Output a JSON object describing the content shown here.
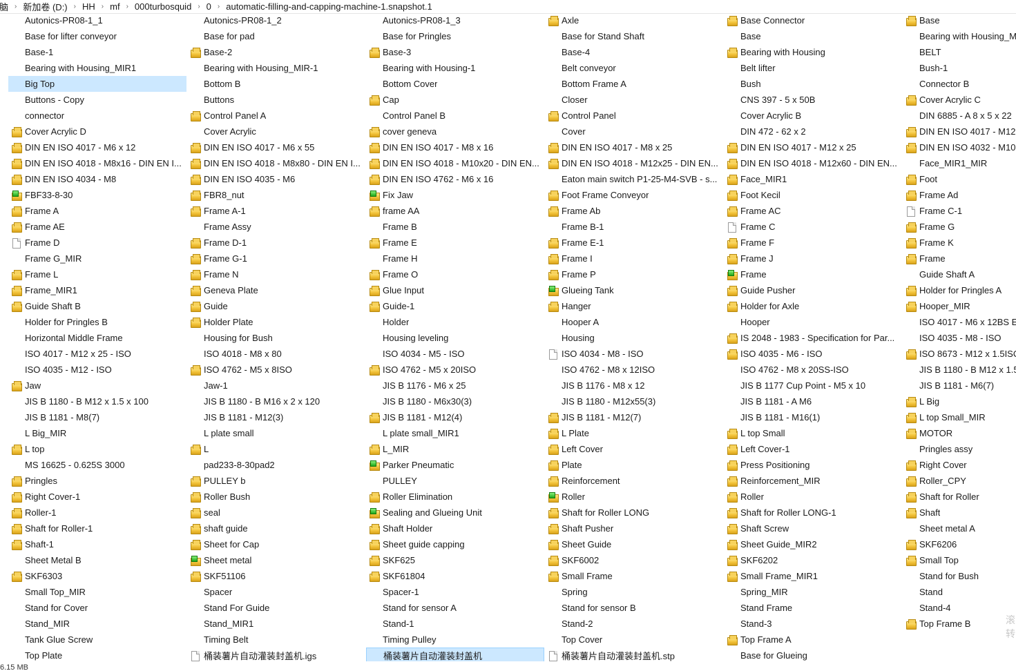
{
  "breadcrumb": [
    "脑",
    "新加卷 (D:)",
    "HH",
    "mf",
    "000turbosquid",
    "0",
    "automatic-filling-and-capping-machine-1.snapshot.1"
  ],
  "status_bar": "6.15 MB",
  "ime_text": "滚\n转",
  "files": [
    {
      "name": "Autonics-PR08-1_1",
      "icon": "none"
    },
    {
      "name": "Base for lifter conveyor",
      "icon": "none"
    },
    {
      "name": "Base-1",
      "icon": "none"
    },
    {
      "name": "Bearing with Housing_MIR1",
      "icon": "none"
    },
    {
      "name": "Big Top",
      "icon": "none",
      "selected": true
    },
    {
      "name": "Buttons - Copy",
      "icon": "none"
    },
    {
      "name": "connector",
      "icon": "none"
    },
    {
      "name": "Cover Acrylic D",
      "icon": "part"
    },
    {
      "name": "DIN EN ISO 4017 - M6 x 12",
      "icon": "part"
    },
    {
      "name": "DIN EN ISO 4018 - M8x16 - DIN EN I...",
      "icon": "part"
    },
    {
      "name": "DIN EN ISO 4034 - M8",
      "icon": "part"
    },
    {
      "name": "FBF33-8-30",
      "icon": "asm"
    },
    {
      "name": "Frame A",
      "icon": "part"
    },
    {
      "name": "Frame AE",
      "icon": "part"
    },
    {
      "name": "Frame D",
      "icon": "file"
    },
    {
      "name": "Frame G_MIR",
      "icon": "none"
    },
    {
      "name": "Frame L",
      "icon": "part"
    },
    {
      "name": "Frame_MIR1",
      "icon": "part"
    },
    {
      "name": "Guide Shaft B",
      "icon": "part"
    },
    {
      "name": "Holder for Pringles B",
      "icon": "none"
    },
    {
      "name": "Horizontal Middle Frame",
      "icon": "none"
    },
    {
      "name": "ISO 4017 - M12 x 25 - ISO",
      "icon": "none"
    },
    {
      "name": "ISO 4035 - M12 - ISO",
      "icon": "none"
    },
    {
      "name": "Jaw",
      "icon": "part"
    },
    {
      "name": "JIS B 1180 - B M12 x 1.5 x 100",
      "icon": "none"
    },
    {
      "name": "JIS B 1181 - M8(7)",
      "icon": "none"
    },
    {
      "name": "L Big_MIR",
      "icon": "none"
    },
    {
      "name": "L top",
      "icon": "part"
    },
    {
      "name": "MS 16625 - 0.625S 3000",
      "icon": "none"
    },
    {
      "name": "Pringles",
      "icon": "part"
    },
    {
      "name": "Right Cover-1",
      "icon": "part"
    },
    {
      "name": "Roller-1",
      "icon": "part"
    },
    {
      "name": "Shaft for Roller-1",
      "icon": "part"
    },
    {
      "name": "Shaft-1",
      "icon": "part"
    },
    {
      "name": "Sheet Metal B",
      "icon": "none"
    },
    {
      "name": "SKF6303",
      "icon": "part"
    },
    {
      "name": "Small Top_MIR",
      "icon": "none"
    },
    {
      "name": "Stand for Cover",
      "icon": "none"
    },
    {
      "name": "Stand_MIR",
      "icon": "none"
    },
    {
      "name": "Tank Glue Screw",
      "icon": "none"
    },
    {
      "name": "Top Plate",
      "icon": "none"
    },
    {
      "name": "Autonics-PR08-1_2",
      "icon": "none"
    },
    {
      "name": "Base for pad",
      "icon": "none"
    },
    {
      "name": "Base-2",
      "icon": "part"
    },
    {
      "name": "Bearing with Housing_MIR-1",
      "icon": "none"
    },
    {
      "name": "Bottom B",
      "icon": "none"
    },
    {
      "name": "Buttons",
      "icon": "none"
    },
    {
      "name": "Control Panel A",
      "icon": "part"
    },
    {
      "name": "Cover Acrylic",
      "icon": "none"
    },
    {
      "name": "DIN EN ISO 4017 - M6 x 55",
      "icon": "part"
    },
    {
      "name": "DIN EN ISO 4018 - M8x80 - DIN EN I...",
      "icon": "part"
    },
    {
      "name": "DIN EN ISO 4035 - M6",
      "icon": "part"
    },
    {
      "name": "FBR8_nut",
      "icon": "part"
    },
    {
      "name": "Frame A-1",
      "icon": "part"
    },
    {
      "name": "Frame Assy",
      "icon": "none"
    },
    {
      "name": "Frame D-1",
      "icon": "part"
    },
    {
      "name": "Frame G-1",
      "icon": "part"
    },
    {
      "name": "Frame N",
      "icon": "part"
    },
    {
      "name": "Geneva Plate",
      "icon": "part"
    },
    {
      "name": "Guide",
      "icon": "part"
    },
    {
      "name": "Holder Plate",
      "icon": "part"
    },
    {
      "name": "Housing for Bush",
      "icon": "none"
    },
    {
      "name": "ISO 4018 - M8 x 80",
      "icon": "none"
    },
    {
      "name": "ISO 4762 - M5 x 8ISO",
      "icon": "part"
    },
    {
      "name": "Jaw-1",
      "icon": "none"
    },
    {
      "name": "JIS B 1180 - B M16 x 2 x 120",
      "icon": "none"
    },
    {
      "name": "JIS B 1181 - M12(3)",
      "icon": "none"
    },
    {
      "name": "L plate small",
      "icon": "none"
    },
    {
      "name": "L",
      "icon": "part"
    },
    {
      "name": "pad233-8-30pad2",
      "icon": "none"
    },
    {
      "name": "PULLEY b",
      "icon": "part"
    },
    {
      "name": "Roller Bush",
      "icon": "part"
    },
    {
      "name": "seal",
      "icon": "part"
    },
    {
      "name": "shaft guide",
      "icon": "part"
    },
    {
      "name": "Sheet for Cap",
      "icon": "part"
    },
    {
      "name": "Sheet metal",
      "icon": "asm"
    },
    {
      "name": "SKF51106",
      "icon": "part"
    },
    {
      "name": "Spacer",
      "icon": "none"
    },
    {
      "name": "Stand For Guide",
      "icon": "none"
    },
    {
      "name": "Stand_MIR1",
      "icon": "none"
    },
    {
      "name": "Timing Belt",
      "icon": "none"
    },
    {
      "name": "桶装薯片自动灌装封盖机.igs",
      "icon": "file"
    },
    {
      "name": "Autonics-PR08-1_3",
      "icon": "none"
    },
    {
      "name": "Base for Pringles",
      "icon": "none"
    },
    {
      "name": "Base-3",
      "icon": "part"
    },
    {
      "name": "Bearing with Housing-1",
      "icon": "none"
    },
    {
      "name": "Bottom Cover",
      "icon": "none"
    },
    {
      "name": "Cap",
      "icon": "part"
    },
    {
      "name": "Control Panel B",
      "icon": "none"
    },
    {
      "name": "cover geneva",
      "icon": "part"
    },
    {
      "name": "DIN EN ISO 4017 - M8 x 16",
      "icon": "part"
    },
    {
      "name": "DIN EN ISO 4018 - M10x20 - DIN EN...",
      "icon": "part"
    },
    {
      "name": "DIN EN ISO 4762 - M6 x 16",
      "icon": "part"
    },
    {
      "name": "Fix Jaw",
      "icon": "asm"
    },
    {
      "name": "frame AA",
      "icon": "part"
    },
    {
      "name": "Frame B",
      "icon": "none"
    },
    {
      "name": "Frame E",
      "icon": "part"
    },
    {
      "name": "Frame H",
      "icon": "none"
    },
    {
      "name": "Frame O",
      "icon": "part"
    },
    {
      "name": "Glue Input",
      "icon": "part"
    },
    {
      "name": "Guide-1",
      "icon": "part"
    },
    {
      "name": "Holder",
      "icon": "none"
    },
    {
      "name": "Housing leveling",
      "icon": "none"
    },
    {
      "name": "ISO 4034 - M5 - ISO",
      "icon": "none"
    },
    {
      "name": "ISO 4762 - M5 x 20ISO",
      "icon": "part"
    },
    {
      "name": "JIS B 1176 - M6 x 25",
      "icon": "none"
    },
    {
      "name": "JIS B 1180 - M6x30(3)",
      "icon": "none"
    },
    {
      "name": "JIS B 1181 - M12(4)",
      "icon": "part"
    },
    {
      "name": "L plate small_MIR1",
      "icon": "none"
    },
    {
      "name": "L_MIR",
      "icon": "part"
    },
    {
      "name": "Parker Pneumatic",
      "icon": "asm"
    },
    {
      "name": "PULLEY",
      "icon": "none"
    },
    {
      "name": "Roller Elimination",
      "icon": "part"
    },
    {
      "name": "Sealing and Glueing Unit",
      "icon": "asm"
    },
    {
      "name": "Shaft Holder",
      "icon": "part"
    },
    {
      "name": "Sheet guide capping",
      "icon": "part"
    },
    {
      "name": "SKF625",
      "icon": "part"
    },
    {
      "name": "SKF61804",
      "icon": "part"
    },
    {
      "name": "Spacer-1",
      "icon": "none"
    },
    {
      "name": "Stand for sensor A",
      "icon": "none"
    },
    {
      "name": "Stand-1",
      "icon": "none"
    },
    {
      "name": "Timing Pulley",
      "icon": "none"
    },
    {
      "name": "桶装薯片自动灌装封盖机",
      "icon": "none",
      "selected": true
    },
    {
      "name": "Axle",
      "icon": "part"
    },
    {
      "name": "Base for Stand Shaft",
      "icon": "none"
    },
    {
      "name": "Base-4",
      "icon": "none"
    },
    {
      "name": "Belt conveyor",
      "icon": "none"
    },
    {
      "name": "Bottom Frame A",
      "icon": "none"
    },
    {
      "name": "Closer",
      "icon": "none"
    },
    {
      "name": "Control Panel",
      "icon": "part"
    },
    {
      "name": "Cover",
      "icon": "none"
    },
    {
      "name": "DIN EN ISO 4017 - M8 x 25",
      "icon": "part"
    },
    {
      "name": "DIN EN ISO 4018 - M12x25 - DIN EN...",
      "icon": "part"
    },
    {
      "name": "Eaton main switch P1-25-M4-SVB - s...",
      "icon": "none"
    },
    {
      "name": "Foot Frame Conveyor",
      "icon": "part"
    },
    {
      "name": "Frame Ab",
      "icon": "part"
    },
    {
      "name": "Frame B-1",
      "icon": "none"
    },
    {
      "name": "Frame E-1",
      "icon": "part"
    },
    {
      "name": "Frame I",
      "icon": "part"
    },
    {
      "name": "Frame P",
      "icon": "part"
    },
    {
      "name": "Glueing Tank",
      "icon": "asm"
    },
    {
      "name": "Hanger",
      "icon": "part"
    },
    {
      "name": "Hooper A",
      "icon": "none"
    },
    {
      "name": "Housing",
      "icon": "none"
    },
    {
      "name": "ISO 4034 - M8 - ISO",
      "icon": "file"
    },
    {
      "name": "ISO 4762 - M8 x 12ISO",
      "icon": "none"
    },
    {
      "name": "JIS B 1176 - M8 x 12",
      "icon": "none"
    },
    {
      "name": "JIS B 1180 - M12x55(3)",
      "icon": "none"
    },
    {
      "name": "JIS B 1181 - M12(7)",
      "icon": "part"
    },
    {
      "name": "L Plate",
      "icon": "part"
    },
    {
      "name": "Left Cover",
      "icon": "part"
    },
    {
      "name": "Plate",
      "icon": "part"
    },
    {
      "name": "Reinforcement",
      "icon": "part"
    },
    {
      "name": "Roller",
      "icon": "asm"
    },
    {
      "name": "Shaft for Roller LONG",
      "icon": "part"
    },
    {
      "name": "Shaft Pusher",
      "icon": "part"
    },
    {
      "name": "Sheet Guide",
      "icon": "part"
    },
    {
      "name": "SKF6002",
      "icon": "part"
    },
    {
      "name": "Small Frame",
      "icon": "part"
    },
    {
      "name": "Spring",
      "icon": "none"
    },
    {
      "name": "Stand for sensor B",
      "icon": "none"
    },
    {
      "name": "Stand-2",
      "icon": "none"
    },
    {
      "name": "Top Cover",
      "icon": "none"
    },
    {
      "name": "桶装薯片自动灌装封盖机.stp",
      "icon": "file"
    },
    {
      "name": "Base Connector",
      "icon": "part"
    },
    {
      "name": "Base",
      "icon": "none"
    },
    {
      "name": "Bearing with Housing",
      "icon": "part"
    },
    {
      "name": "Belt lifter",
      "icon": "none"
    },
    {
      "name": "Bush",
      "icon": "none"
    },
    {
      "name": "CNS 397 - 5 x 50B",
      "icon": "none"
    },
    {
      "name": "Cover Acrylic B",
      "icon": "none"
    },
    {
      "name": "DIN 472 - 62 x 2",
      "icon": "none"
    },
    {
      "name": "DIN EN ISO 4017 - M12 x 25",
      "icon": "part"
    },
    {
      "name": "DIN EN ISO 4018 - M12x60 - DIN EN...",
      "icon": "part"
    },
    {
      "name": "Face_MIR1",
      "icon": "part"
    },
    {
      "name": "Foot Kecil",
      "icon": "part"
    },
    {
      "name": "Frame AC",
      "icon": "part"
    },
    {
      "name": "Frame C",
      "icon": "file"
    },
    {
      "name": "Frame F",
      "icon": "part"
    },
    {
      "name": "Frame J",
      "icon": "part"
    },
    {
      "name": "Frame",
      "icon": "asm"
    },
    {
      "name": "Guide Pusher",
      "icon": "part"
    },
    {
      "name": "Holder for Axle",
      "icon": "part"
    },
    {
      "name": "Hooper",
      "icon": "none"
    },
    {
      "name": "IS 2048 - 1983 - Specification for Par...",
      "icon": "part"
    },
    {
      "name": "ISO 4035 - M6 - ISO",
      "icon": "part"
    },
    {
      "name": "ISO 4762 - M8 x 20SS-ISO",
      "icon": "none"
    },
    {
      "name": "JIS B 1177 Cup Point - M5 x 10",
      "icon": "none"
    },
    {
      "name": "JIS B 1181 - A M6",
      "icon": "none"
    },
    {
      "name": "JIS B 1181 - M16(1)",
      "icon": "none"
    },
    {
      "name": "L top Small",
      "icon": "part"
    },
    {
      "name": "Left Cover-1",
      "icon": "part"
    },
    {
      "name": "Press Positioning",
      "icon": "part"
    },
    {
      "name": "Reinforcement_MIR",
      "icon": "part"
    },
    {
      "name": "Roller",
      "icon": "part"
    },
    {
      "name": "Shaft for Roller LONG-1",
      "icon": "part"
    },
    {
      "name": "Shaft Screw",
      "icon": "part"
    },
    {
      "name": "Sheet Guide_MIR2",
      "icon": "part"
    },
    {
      "name": "SKF6202",
      "icon": "part"
    },
    {
      "name": "Small Frame_MIR1",
      "icon": "part"
    },
    {
      "name": "Spring_MIR",
      "icon": "none"
    },
    {
      "name": "Stand Frame",
      "icon": "none"
    },
    {
      "name": "Stand-3",
      "icon": "none"
    },
    {
      "name": "Top Frame A",
      "icon": "part"
    },
    {
      "name": "Base for Glueing",
      "icon": "none"
    },
    {
      "name": "Base",
      "icon": "part"
    },
    {
      "name": "Bearing with Housing_M",
      "icon": "none"
    },
    {
      "name": "BELT",
      "icon": "none"
    },
    {
      "name": "Bush-1",
      "icon": "none"
    },
    {
      "name": "Connector B",
      "icon": "none"
    },
    {
      "name": "Cover Acrylic C",
      "icon": "part"
    },
    {
      "name": "DIN 6885 - A 8 x 5 x 22",
      "icon": "none"
    },
    {
      "name": "DIN EN ISO 4017 - M12",
      "icon": "part"
    },
    {
      "name": "DIN EN ISO 4032 - M10",
      "icon": "part"
    },
    {
      "name": "Face_MIR1_MIR",
      "icon": "none"
    },
    {
      "name": "Foot",
      "icon": "part"
    },
    {
      "name": "Frame Ad",
      "icon": "part"
    },
    {
      "name": "Frame C-1",
      "icon": "file"
    },
    {
      "name": "Frame G",
      "icon": "part"
    },
    {
      "name": "Frame K",
      "icon": "part"
    },
    {
      "name": "Frame",
      "icon": "part"
    },
    {
      "name": "Guide Shaft A",
      "icon": "none"
    },
    {
      "name": "Holder for Pringles A",
      "icon": "part"
    },
    {
      "name": "Hooper_MIR",
      "icon": "part"
    },
    {
      "name": "ISO 4017 - M6 x 12BS E",
      "icon": "none"
    },
    {
      "name": "ISO 4035 - M8 - ISO",
      "icon": "none"
    },
    {
      "name": "ISO 8673 - M12 x 1.5ISO",
      "icon": "part"
    },
    {
      "name": "JIS B 1180 - B M12 x 1.5",
      "icon": "none"
    },
    {
      "name": "JIS B 1181 - M6(7)",
      "icon": "none"
    },
    {
      "name": "L Big",
      "icon": "part"
    },
    {
      "name": "L top Small_MIR",
      "icon": "part"
    },
    {
      "name": "MOTOR",
      "icon": "part"
    },
    {
      "name": "Pringles assy",
      "icon": "none"
    },
    {
      "name": "Right Cover",
      "icon": "part"
    },
    {
      "name": "Roller_CPY",
      "icon": "part"
    },
    {
      "name": "Shaft for Roller",
      "icon": "part"
    },
    {
      "name": "Shaft",
      "icon": "part"
    },
    {
      "name": "Sheet metal A",
      "icon": "none"
    },
    {
      "name": "SKF6206",
      "icon": "part"
    },
    {
      "name": "Small Top",
      "icon": "part"
    },
    {
      "name": "Stand for Bush",
      "icon": "none"
    },
    {
      "name": "Stand",
      "icon": "none"
    },
    {
      "name": "Stand-4",
      "icon": "none"
    },
    {
      "name": "Top Frame B",
      "icon": "part"
    }
  ]
}
